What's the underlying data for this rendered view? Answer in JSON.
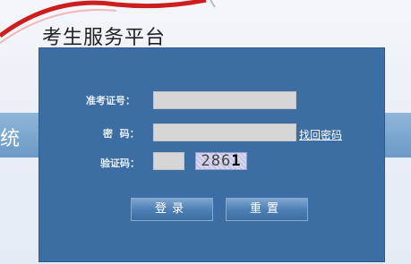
{
  "header": {
    "platform_title": "考生服务平台",
    "side_banner_text": "统"
  },
  "login_form": {
    "ticket_label": "准考证号：",
    "ticket_value": "",
    "password_label": "密  码：",
    "password_value": "",
    "forgot_password_link": "找回密码",
    "captcha_label": "验证码：",
    "captcha_value": "",
    "captcha_digits": [
      "2",
      "8",
      "6",
      "1"
    ],
    "submit_label": "登录",
    "reset_label": "重置"
  },
  "colors": {
    "panel": "#3c6ea3",
    "input": "#d6d6d6",
    "ribbon": "#d02020"
  }
}
